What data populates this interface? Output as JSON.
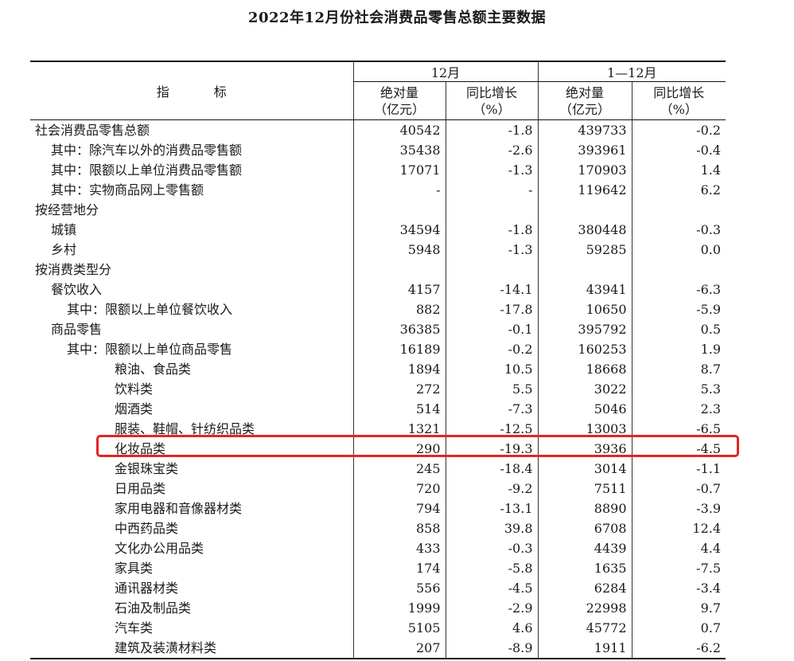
{
  "title": "2022年12月份社会消费品零售总额主要数据",
  "header": {
    "indicator": "指　标",
    "group_december": "12月",
    "group_year": "1—12月",
    "abs_label": "绝对量",
    "abs_unit": "（亿元）",
    "growth_label": "同比增长",
    "growth_unit": "（%）"
  },
  "rows": [
    {
      "label": "社会消费品零售总额",
      "level": 0,
      "dec_abs": "40542",
      "dec_growth": "-1.8",
      "ytd_abs": "439733",
      "ytd_growth": "-0.2"
    },
    {
      "label": "其中：除汽车以外的消费品零售额",
      "level": 1,
      "dec_abs": "35438",
      "dec_growth": "-2.6",
      "ytd_abs": "393961",
      "ytd_growth": "-0.4"
    },
    {
      "label": "其中：限额以上单位消费品零售额",
      "level": 1,
      "dec_abs": "17071",
      "dec_growth": "-1.3",
      "ytd_abs": "170903",
      "ytd_growth": "1.4"
    },
    {
      "label": "其中：实物商品网上零售额",
      "level": 1,
      "dec_abs": "-",
      "dec_growth": "-",
      "ytd_abs": "119642",
      "ytd_growth": "6.2"
    },
    {
      "label": "按经营地分",
      "level": 0,
      "dec_abs": "",
      "dec_growth": "",
      "ytd_abs": "",
      "ytd_growth": ""
    },
    {
      "label": "城镇",
      "level": 1,
      "dec_abs": "34594",
      "dec_growth": "-1.8",
      "ytd_abs": "380448",
      "ytd_growth": "-0.3"
    },
    {
      "label": "乡村",
      "level": 1,
      "dec_abs": "5948",
      "dec_growth": "-1.3",
      "ytd_abs": "59285",
      "ytd_growth": "0.0"
    },
    {
      "label": "按消费类型分",
      "level": 0,
      "dec_abs": "",
      "dec_growth": "",
      "ytd_abs": "",
      "ytd_growth": ""
    },
    {
      "label": "餐饮收入",
      "level": 1,
      "dec_abs": "4157",
      "dec_growth": "-14.1",
      "ytd_abs": "43941",
      "ytd_growth": "-6.3"
    },
    {
      "label": "其中：限额以上单位餐饮收入",
      "level": 2,
      "dec_abs": "882",
      "dec_growth": "-17.8",
      "ytd_abs": "10650",
      "ytd_growth": "-5.9"
    },
    {
      "label": "商品零售",
      "level": 1,
      "dec_abs": "36385",
      "dec_growth": "-0.1",
      "ytd_abs": "395792",
      "ytd_growth": "0.5"
    },
    {
      "label": "其中：限额以上单位商品零售",
      "level": 2,
      "dec_abs": "16189",
      "dec_growth": "-0.2",
      "ytd_abs": "160253",
      "ytd_growth": "1.9"
    },
    {
      "label": "粮油、食品类",
      "level": 3,
      "dec_abs": "1894",
      "dec_growth": "10.5",
      "ytd_abs": "18668",
      "ytd_growth": "8.7"
    },
    {
      "label": "饮料类",
      "level": 3,
      "dec_abs": "272",
      "dec_growth": "5.5",
      "ytd_abs": "3022",
      "ytd_growth": "5.3"
    },
    {
      "label": "烟酒类",
      "level": 3,
      "dec_abs": "514",
      "dec_growth": "-7.3",
      "ytd_abs": "5046",
      "ytd_growth": "2.3"
    },
    {
      "label": "服装、鞋帽、针纺织品类",
      "level": 3,
      "dec_abs": "1321",
      "dec_growth": "-12.5",
      "ytd_abs": "13003",
      "ytd_growth": "-6.5"
    },
    {
      "label": "化妆品类",
      "level": 3,
      "dec_abs": "290",
      "dec_growth": "-19.3",
      "ytd_abs": "3936",
      "ytd_growth": "-4.5"
    },
    {
      "label": "金银珠宝类",
      "level": 3,
      "dec_abs": "245",
      "dec_growth": "-18.4",
      "ytd_abs": "3014",
      "ytd_growth": "-1.1"
    },
    {
      "label": "日用品类",
      "level": 3,
      "dec_abs": "720",
      "dec_growth": "-9.2",
      "ytd_abs": "7511",
      "ytd_growth": "-0.7"
    },
    {
      "label": "家用电器和音像器材类",
      "level": 3,
      "dec_abs": "794",
      "dec_growth": "-13.1",
      "ytd_abs": "8890",
      "ytd_growth": "-3.9"
    },
    {
      "label": "中西药品类",
      "level": 3,
      "dec_abs": "858",
      "dec_growth": "39.8",
      "ytd_abs": "6708",
      "ytd_growth": "12.4"
    },
    {
      "label": "文化办公用品类",
      "level": 3,
      "dec_abs": "433",
      "dec_growth": "-0.3",
      "ytd_abs": "4439",
      "ytd_growth": "4.4"
    },
    {
      "label": "家具类",
      "level": 3,
      "dec_abs": "174",
      "dec_growth": "-5.8",
      "ytd_abs": "1635",
      "ytd_growth": "-7.5"
    },
    {
      "label": "通讯器材类",
      "level": 3,
      "dec_abs": "556",
      "dec_growth": "-4.5",
      "ytd_abs": "6284",
      "ytd_growth": "-3.4"
    },
    {
      "label": "石油及制品类",
      "level": 3,
      "dec_abs": "1999",
      "dec_growth": "-2.9",
      "ytd_abs": "22998",
      "ytd_growth": "9.7"
    },
    {
      "label": "汽车类",
      "level": 3,
      "dec_abs": "5105",
      "dec_growth": "4.6",
      "ytd_abs": "45772",
      "ytd_growth": "0.7"
    },
    {
      "label": "建筑及装潢材料类",
      "level": 3,
      "dec_abs": "207",
      "dec_growth": "-8.9",
      "ytd_abs": "1911",
      "ytd_growth": "-6.2"
    }
  ],
  "highlighted_row": "化妆品类",
  "colors": {
    "highlight_border": "#e32424",
    "rule": "#111111",
    "text": "#1a1a1a"
  }
}
